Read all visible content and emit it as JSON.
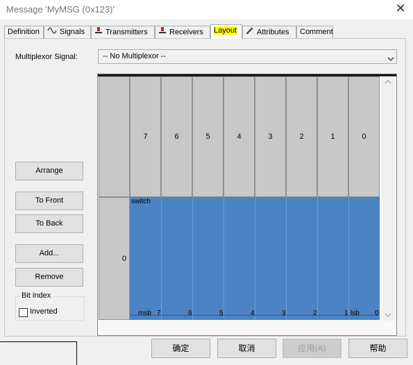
{
  "window": {
    "title": "Message 'MyMSG (0x123)'",
    "close_glyph": "✕"
  },
  "tabs": [
    {
      "label": "Definition",
      "icon": ""
    },
    {
      "label": "Signals",
      "icon": "signals-icon"
    },
    {
      "label": "Transmitters",
      "icon": "transmitter-icon"
    },
    {
      "label": "Receivers",
      "icon": "receiver-icon"
    },
    {
      "label": "Layout",
      "icon": "",
      "active": true
    },
    {
      "label": "Attributes",
      "icon": "attributes-icon"
    },
    {
      "label": "Comment",
      "icon": ""
    }
  ],
  "multiplexor": {
    "label": "Multiplexor Signal:",
    "value": "-- No Multiplexor --"
  },
  "side_buttons": {
    "arrange": "Arrange",
    "to_front": "To Front",
    "to_back": "To Back",
    "add": "Add...",
    "remove": "Remove"
  },
  "bit_index": {
    "legend": "Bit index",
    "inverted_label": "Inverted",
    "inverted": false
  },
  "layout_grid": {
    "bit_headers": [
      "7",
      "6",
      "5",
      "4",
      "3",
      "2",
      "1",
      "0"
    ],
    "byte_rows": [
      "0"
    ],
    "signal": {
      "name": "switch",
      "msb_label": "msb",
      "lsb_label": "lsb",
      "bit_labels": [
        "7",
        "6",
        "5",
        "4",
        "3",
        "2",
        "1",
        "0"
      ],
      "color": "#4a84c4"
    }
  },
  "footer": {
    "ok": "确定",
    "cancel": "取消",
    "apply": "应用(A)",
    "help": "帮助"
  },
  "colors": {
    "highlight": "#ffff00",
    "signal_fill": "#4a84c4",
    "grid_header": "#c8c8c8"
  }
}
